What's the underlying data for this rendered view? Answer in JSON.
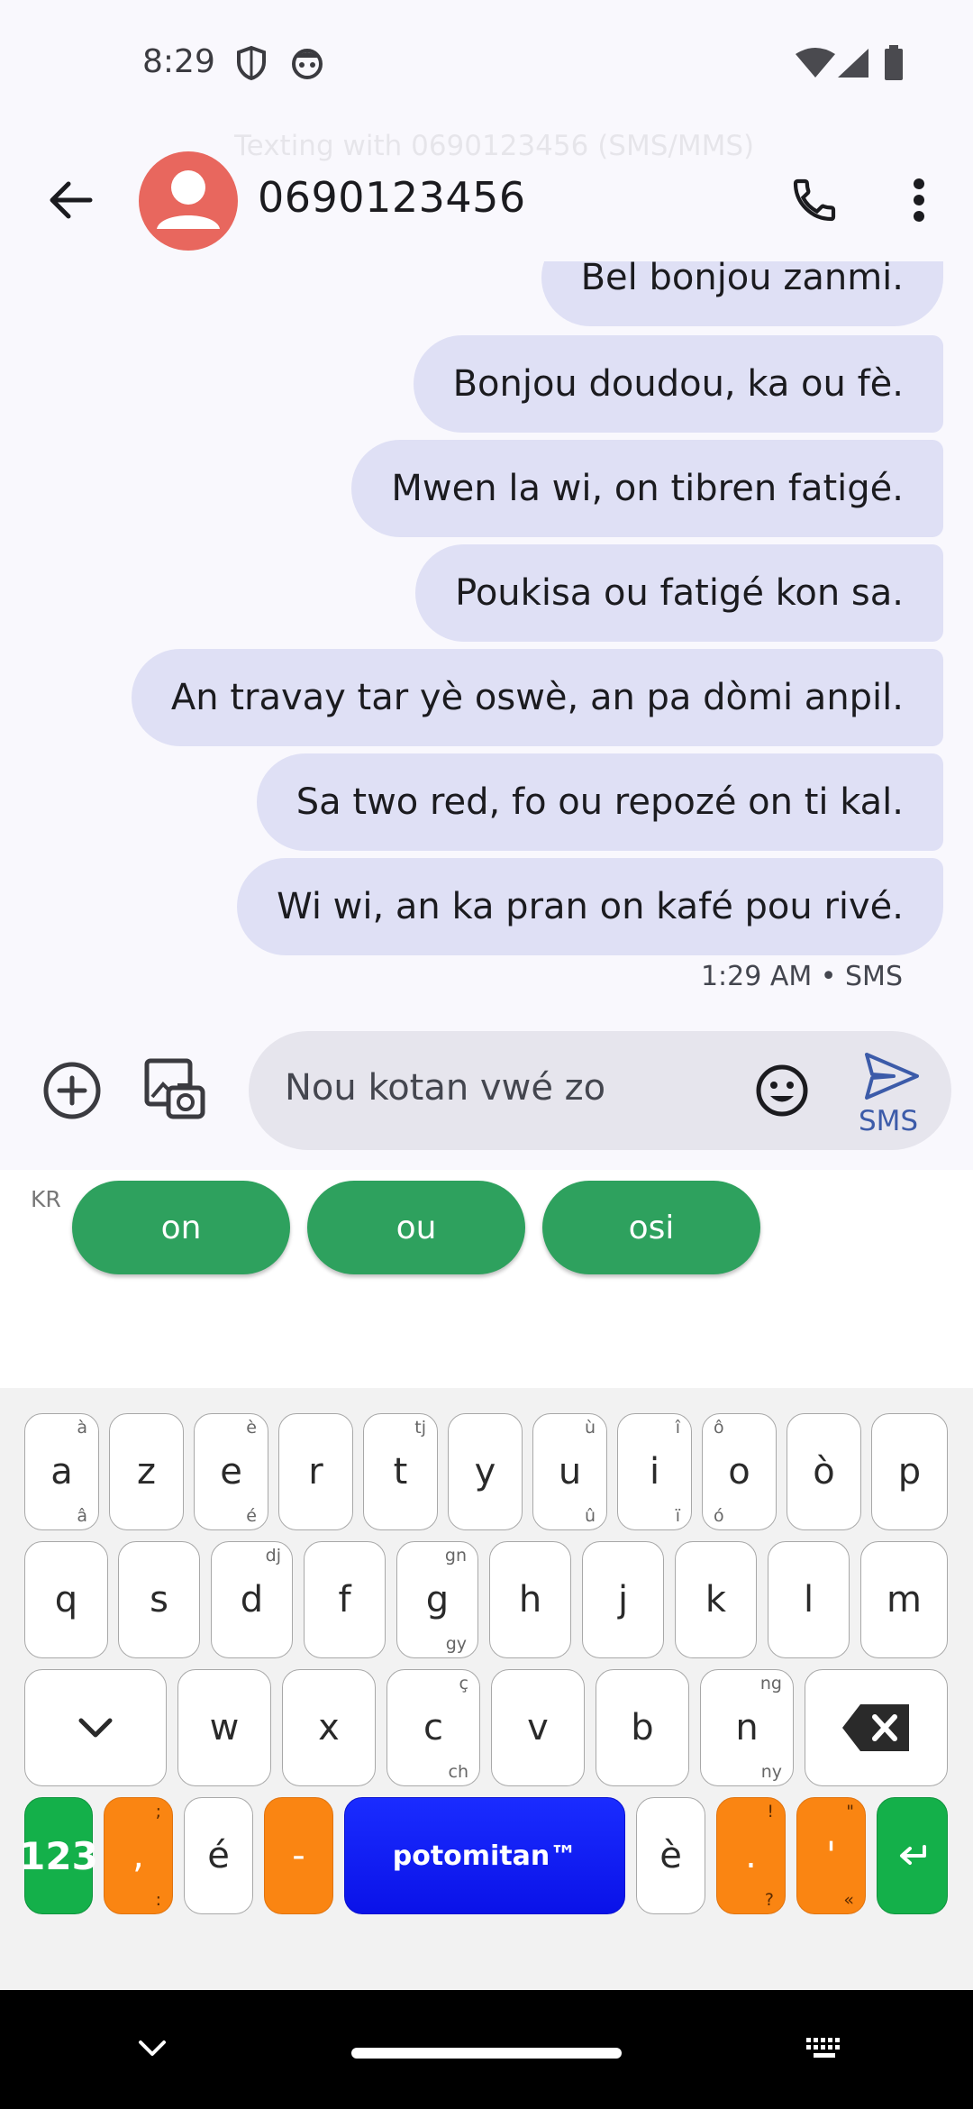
{
  "status_bar": {
    "time": "8:29",
    "left_icons": [
      "shield-icon",
      "face-icon"
    ],
    "right_icons": [
      "wifi-icon",
      "signal-icon",
      "battery-icon"
    ]
  },
  "header": {
    "subtitle": "Texting with 0690123456 (SMS/MMS)",
    "contact": "0690123456",
    "icons": [
      "back-arrow-icon",
      "avatar-icon",
      "phone-icon",
      "more-vert-icon"
    ]
  },
  "messages": [
    {
      "text": "Bel bonjou zanmi."
    },
    {
      "text": "Bonjou doudou, ka ou fè."
    },
    {
      "text": "Mwen la wi, on tibren fatigé."
    },
    {
      "text": "Poukisa ou fatigé kon sa."
    },
    {
      "text": "An travay tar yè oswè, an pa dòmi anpil."
    },
    {
      "text": "Sa two red, fo ou repozé on ti kal."
    },
    {
      "text": "Wi wi, an ka pran on kafé pou rivé."
    }
  ],
  "message_meta": "1:29 AM • SMS",
  "compose": {
    "text": "Nou kotan vwé zo",
    "send_label": "SMS",
    "icons": [
      "add-circle-icon",
      "gallery-icon",
      "emoji-icon",
      "send-icon"
    ]
  },
  "suggestions": {
    "lang": "KR",
    "chips": [
      "on",
      "ou",
      "osi"
    ]
  },
  "keyboard": {
    "row1": [
      {
        "k": "a",
        "t": "à",
        "b": "â"
      },
      {
        "k": "z"
      },
      {
        "k": "e",
        "t": "è",
        "b": "é"
      },
      {
        "k": "r"
      },
      {
        "k": "t",
        "t": "tj"
      },
      {
        "k": "y"
      },
      {
        "k": "u",
        "t": "ù",
        "b": "û"
      },
      {
        "k": "i",
        "t": "î",
        "b": "ï"
      },
      {
        "k": "o",
        "tl": "ô",
        "bl": "ó"
      },
      {
        "k": "ò"
      },
      {
        "k": "p"
      }
    ],
    "row2": [
      {
        "k": "q"
      },
      {
        "k": "s"
      },
      {
        "k": "d",
        "t": "dj"
      },
      {
        "k": "f"
      },
      {
        "k": "g",
        "t": "gn",
        "b": "gy"
      },
      {
        "k": "h"
      },
      {
        "k": "j"
      },
      {
        "k": "k"
      },
      {
        "k": "l"
      },
      {
        "k": "m"
      }
    ],
    "row3": [
      {
        "k": "w"
      },
      {
        "k": "x"
      },
      {
        "k": "c",
        "t": "ç",
        "b": "ch"
      },
      {
        "k": "v"
      },
      {
        "k": "b"
      },
      {
        "k": "n",
        "t": "ng",
        "b": "ny"
      }
    ],
    "row4": {
      "numbers": "123",
      "comma": {
        "k": ",",
        "t": ";",
        "b": ":"
      },
      "e_acute": "é",
      "dash": "-",
      "space": "potomitan™",
      "e_grave": "è",
      "period": {
        "k": ".",
        "t": "!",
        "b": "?"
      },
      "apostrophe": {
        "k": "'",
        "t": "\"",
        "b": "«"
      }
    },
    "icons": [
      "chevron-down-icon",
      "backspace-icon",
      "enter-icon"
    ],
    "colors": {
      "green": "#14b04a",
      "orange": "#fa8512",
      "blue": "#1a2cff",
      "chip": "#2ea15e"
    }
  },
  "nav_bar": {
    "icons": [
      "nav-chevron-down-icon",
      "keyboard-icon",
      "home-handle"
    ]
  }
}
